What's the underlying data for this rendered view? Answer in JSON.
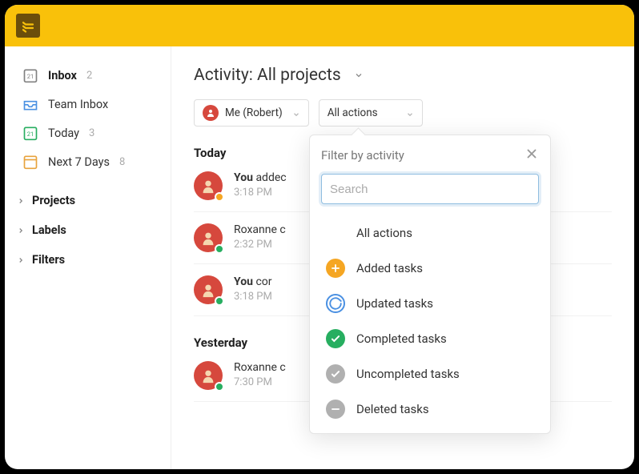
{
  "sidebar": {
    "items": [
      {
        "icon": "inbox",
        "label": "Inbox",
        "count": "2",
        "bold": true,
        "color": "#808080"
      },
      {
        "icon": "team-inbox",
        "label": "Team Inbox",
        "count": "",
        "bold": false,
        "color": "#4a90e2"
      },
      {
        "icon": "today",
        "label": "Today",
        "count": "3",
        "bold": false,
        "color": "#27ae60"
      },
      {
        "icon": "next7",
        "label": "Next 7 Days",
        "count": "8",
        "bold": false,
        "color": "#e8a33d"
      }
    ],
    "sections": [
      {
        "label": "Projects"
      },
      {
        "label": "Labels"
      },
      {
        "label": "Filters"
      }
    ]
  },
  "main": {
    "title": "Activity: All projects",
    "filter_user": "Me (Robert)",
    "filter_action": "All actions",
    "groups": [
      {
        "heading": "Today",
        "rows": [
          {
            "who": "You",
            "verb": " addec",
            "time": "3:18 PM",
            "avatar_color": "#d6483d",
            "badge_color": "#f5a623"
          },
          {
            "who": "",
            "verb": "Roxanne c",
            "time": "2:32 PM",
            "avatar_color": "#d6483d",
            "badge_color": "#27ae60"
          },
          {
            "who": "You",
            "verb": " cor",
            "time": "3:18 PM",
            "avatar_color": "#d6483d",
            "badge_color": "#27ae60"
          }
        ]
      },
      {
        "heading": "Yesterday",
        "rows": [
          {
            "who": "",
            "verb": "Roxanne c",
            "time": "7:30 PM",
            "avatar_color": "#d6483d",
            "badge_color": "#27ae60"
          }
        ]
      }
    ]
  },
  "popover": {
    "title": "Filter by activity",
    "search_placeholder": "Search",
    "options": [
      {
        "label": "All actions",
        "icon": "none",
        "color": "transparent"
      },
      {
        "label": "Added tasks",
        "icon": "plus",
        "color": "#f5a623"
      },
      {
        "label": "Updated tasks",
        "icon": "refresh",
        "color": "#4a90e2"
      },
      {
        "label": "Completed tasks",
        "icon": "check",
        "color": "#27ae60"
      },
      {
        "label": "Uncompleted tasks",
        "icon": "check",
        "color": "#b0b0b0"
      },
      {
        "label": "Deleted tasks",
        "icon": "minus",
        "color": "#b0b0b0"
      }
    ]
  }
}
